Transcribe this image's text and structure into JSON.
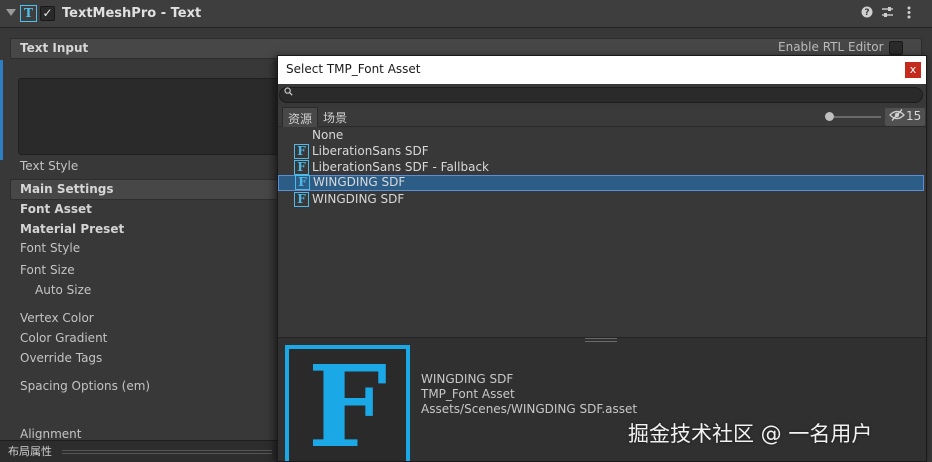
{
  "component": {
    "title": "TextMeshPro - Text",
    "icon_glyph": "T",
    "enabled_check": "✓",
    "header_icons": [
      "help-icon",
      "presets-icon",
      "menu-icon"
    ]
  },
  "text_input": {
    "section_label": "Text Input",
    "rtl_label": "Enable RTL Editor",
    "text_style_label": "Text Style"
  },
  "main_settings": {
    "section_label": "Main Settings",
    "properties": {
      "font_asset": "Font Asset",
      "material_preset": "Material Preset",
      "font_style": "Font Style",
      "font_size": "Font Size",
      "auto_size": "Auto Size",
      "vertex_color": "Vertex Color",
      "color_gradient": "Color Gradient",
      "override_tags": "Override Tags",
      "spacing_options": "Spacing Options (em)",
      "alignment": "Alignment"
    }
  },
  "bottom_bar": {
    "label": "布局属性"
  },
  "picker": {
    "title": "Select TMP_Font Asset",
    "close_glyph": "x",
    "search_value": "",
    "tabs": [
      "资源",
      "场景"
    ],
    "hidden_count": "15",
    "items": [
      {
        "label": "None",
        "has_icon": false,
        "selected": false
      },
      {
        "label": "LiberationSans SDF",
        "has_icon": true,
        "selected": false
      },
      {
        "label": "LiberationSans SDF - Fallback",
        "has_icon": true,
        "selected": false
      },
      {
        "label": "WINGDING SDF",
        "has_icon": true,
        "selected": true
      },
      {
        "label": "WINGDING SDF",
        "has_icon": true,
        "selected": false
      }
    ],
    "preview": {
      "icon_glyph": "F",
      "name": "WINGDING SDF",
      "type": "TMP_Font Asset",
      "path": "Assets/Scenes/WINGDING SDF.asset"
    }
  },
  "watermark": "掘金技术社区 @ 一名用户",
  "colors": {
    "accent": "#1aa8e6",
    "selection": "#2c5d87",
    "panel": "#383838",
    "close": "#c42b1c"
  }
}
